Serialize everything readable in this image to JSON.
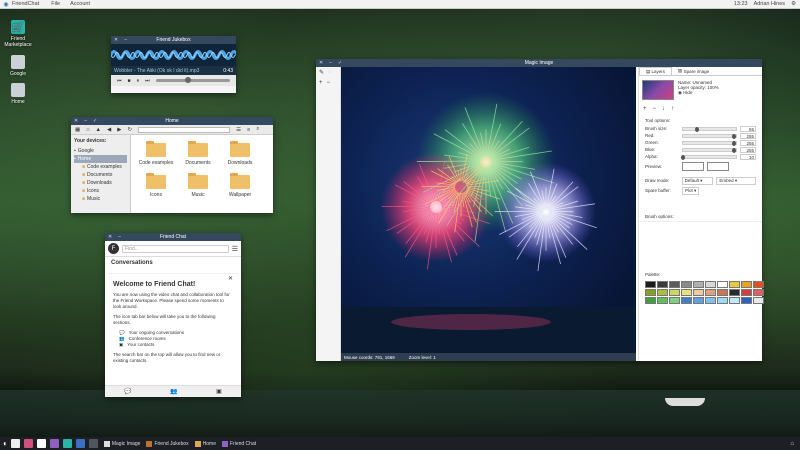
{
  "topbar": {
    "app": "FriendChat",
    "menu_file": "File",
    "menu_account": "Account",
    "time": "13:23",
    "user": "Adrian Hines"
  },
  "desktop_icons": [
    {
      "label": "Friend\nMarketplace",
      "color": "#2ab3a6"
    },
    {
      "label": "Google",
      "color": "#ccd1d8"
    },
    {
      "label": "Home",
      "color": "#ccd1d8"
    }
  ],
  "jukebox": {
    "title": "Friend Jukebox",
    "track": "Wobbler - The Aiiki (Ok ok I did it).mp3",
    "time": "0:43"
  },
  "home": {
    "title": "Home",
    "side_heading": "Your devices:",
    "devices": [
      "Google",
      "Home"
    ],
    "subfolders": [
      "Code examples",
      "Documents",
      "Downloads",
      "Icons",
      "Music"
    ],
    "folders": [
      "Code examples",
      "Documents",
      "Downloads",
      "Icons",
      "Music",
      "Wallpaper"
    ]
  },
  "chat": {
    "title": "Friend Chat",
    "search_placeholder": "Find...",
    "conversations": "Conversations",
    "welcome": "Welcome to Friend Chat!",
    "p1": "You are now using the video chat and collaboration tool for the Friend Workspace. Please spend some moments to look around.",
    "p2": "The icon tab bar below will take you to the following sections.",
    "items": [
      "Your ongoing conversations",
      "Conference rooms",
      "Your contacts"
    ],
    "p3": "The search bar on the top will allow you to find new or existing contacts."
  },
  "magic": {
    "title": "Magic Image",
    "status_coords": "Mouse coords: 791, 1669",
    "status_zoom": "Zoom level: 1",
    "tab_layers": "Layers",
    "tab_spare": "Spare image",
    "layer_name": "Name: Unnamed",
    "layer_opacity": "Layer opacity: 100%",
    "layer_hide": "Hide",
    "tool_options": "Tool options:",
    "rows": [
      {
        "label": "Brush size:",
        "value": "55",
        "level": 0.3
      },
      {
        "label": "Red:",
        "value": "255",
        "level": 1.0
      },
      {
        "label": "Green:",
        "value": "255",
        "level": 1.0
      },
      {
        "label": "Blue:",
        "value": "255",
        "level": 1.0
      },
      {
        "label": "Alpha:",
        "value": "10",
        "level": 0.04
      }
    ],
    "preview": "Preview:",
    "draw_mode": "Draw mode:",
    "draw_mode_val": "Default",
    "draw_mode_val2": "Embed",
    "spare_buffer": "Spare buffer:",
    "spare_val": "Plot",
    "brush_options": "Brush options:",
    "palette_label": "Palette:",
    "palette": [
      "#1a1a1a",
      "#3a3a3a",
      "#5c5c5c",
      "#8a8a8a",
      "#b0b0b0",
      "#d8d8d8",
      "#ffffff",
      "#e8c840",
      "#f0a020",
      "#e05020",
      "#88a020",
      "#a8c040",
      "#c8d860",
      "#e8e080",
      "#f0c8a0",
      "#e0a080",
      "#c87858",
      "#2a2a2a",
      "#d04040",
      "#e06060",
      "#40a040",
      "#60c060",
      "#80d080",
      "#4080c0",
      "#60a0e0",
      "#80c0f0",
      "#a0d8f8",
      "#c0e8f8",
      "#3060c0",
      "#e8e8e8"
    ]
  },
  "taskbar": {
    "tasks": [
      "Magic Image",
      "Friend Jukebox",
      "Home",
      "Friend Chat"
    ],
    "icon_colors": [
      "#eeeeee",
      "#d05080",
      "#ffffff",
      "#9060c0",
      "#2ab3a6",
      "#3a70c0",
      "#505560"
    ]
  }
}
